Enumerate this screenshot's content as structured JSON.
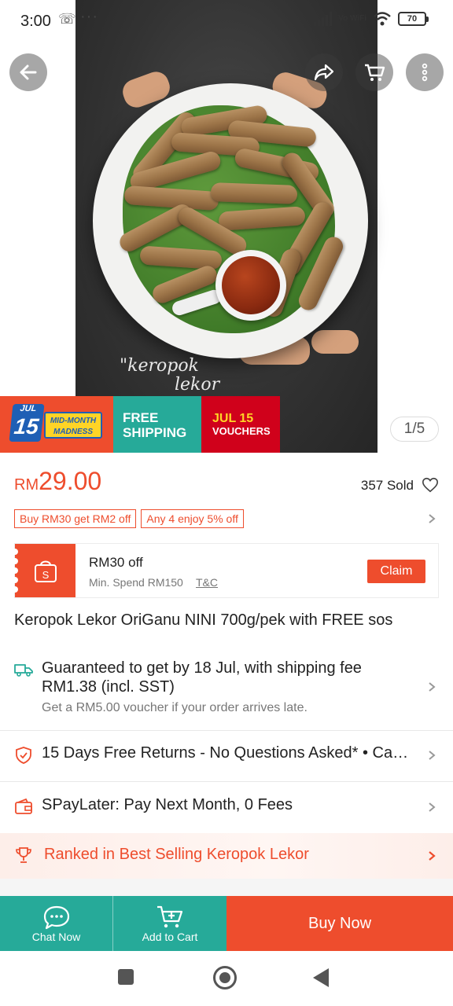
{
  "status_bar": {
    "time": "3:00",
    "network": "Vo WiFi",
    "battery": "70"
  },
  "hero": {
    "caption_line1": "\"keropok",
    "caption_line2": "lekor",
    "counter": "1/5"
  },
  "banner": {
    "jul": "JUL",
    "day": "15",
    "mid_month": "MID-MONTH MADNESS",
    "free_shipping_1": "FREE",
    "free_shipping_2": "SHIPPING",
    "vouchers_1": "JUL 15",
    "vouchers_2": "VOUCHERS"
  },
  "price": {
    "currency": "RM",
    "amount": "29.00",
    "sold": "357 Sold"
  },
  "promos": [
    "Buy RM30 get RM2 off",
    "Any 4 enjoy 5% off"
  ],
  "voucher": {
    "title": "RM30 off",
    "min_spend": "Min. Spend RM150",
    "tnc": "T&C",
    "claim": "Claim"
  },
  "product_title": "Keropok Lekor OriGanu NINI 700g/pek with FREE sos",
  "shipping": {
    "line1": "Guaranteed to get by 18 Jul, with shipping fee RM1.38 (incl. SST)",
    "line2": "Get a RM5.00 voucher if your order arrives late."
  },
  "returns": "15 Days Free Returns - No Questions Asked*  •  Ca…",
  "spaylater": "SPayLater: Pay Next Month, 0 Fees",
  "ranked": "Ranked in Best Selling Keropok Lekor",
  "bottom_bar": {
    "chat": "Chat Now",
    "cart": "Add to Cart",
    "buy": "Buy Now"
  },
  "colors": {
    "brand": "#ee4d2d",
    "teal": "#26aa99"
  },
  "icons": [
    "back-arrow-icon",
    "share-icon",
    "cart-icon",
    "more-icon",
    "heart-icon",
    "shopee-bag-icon",
    "truck-icon",
    "shield-icon",
    "wallet-icon",
    "trophy-icon",
    "chat-icon",
    "add-cart-icon"
  ]
}
